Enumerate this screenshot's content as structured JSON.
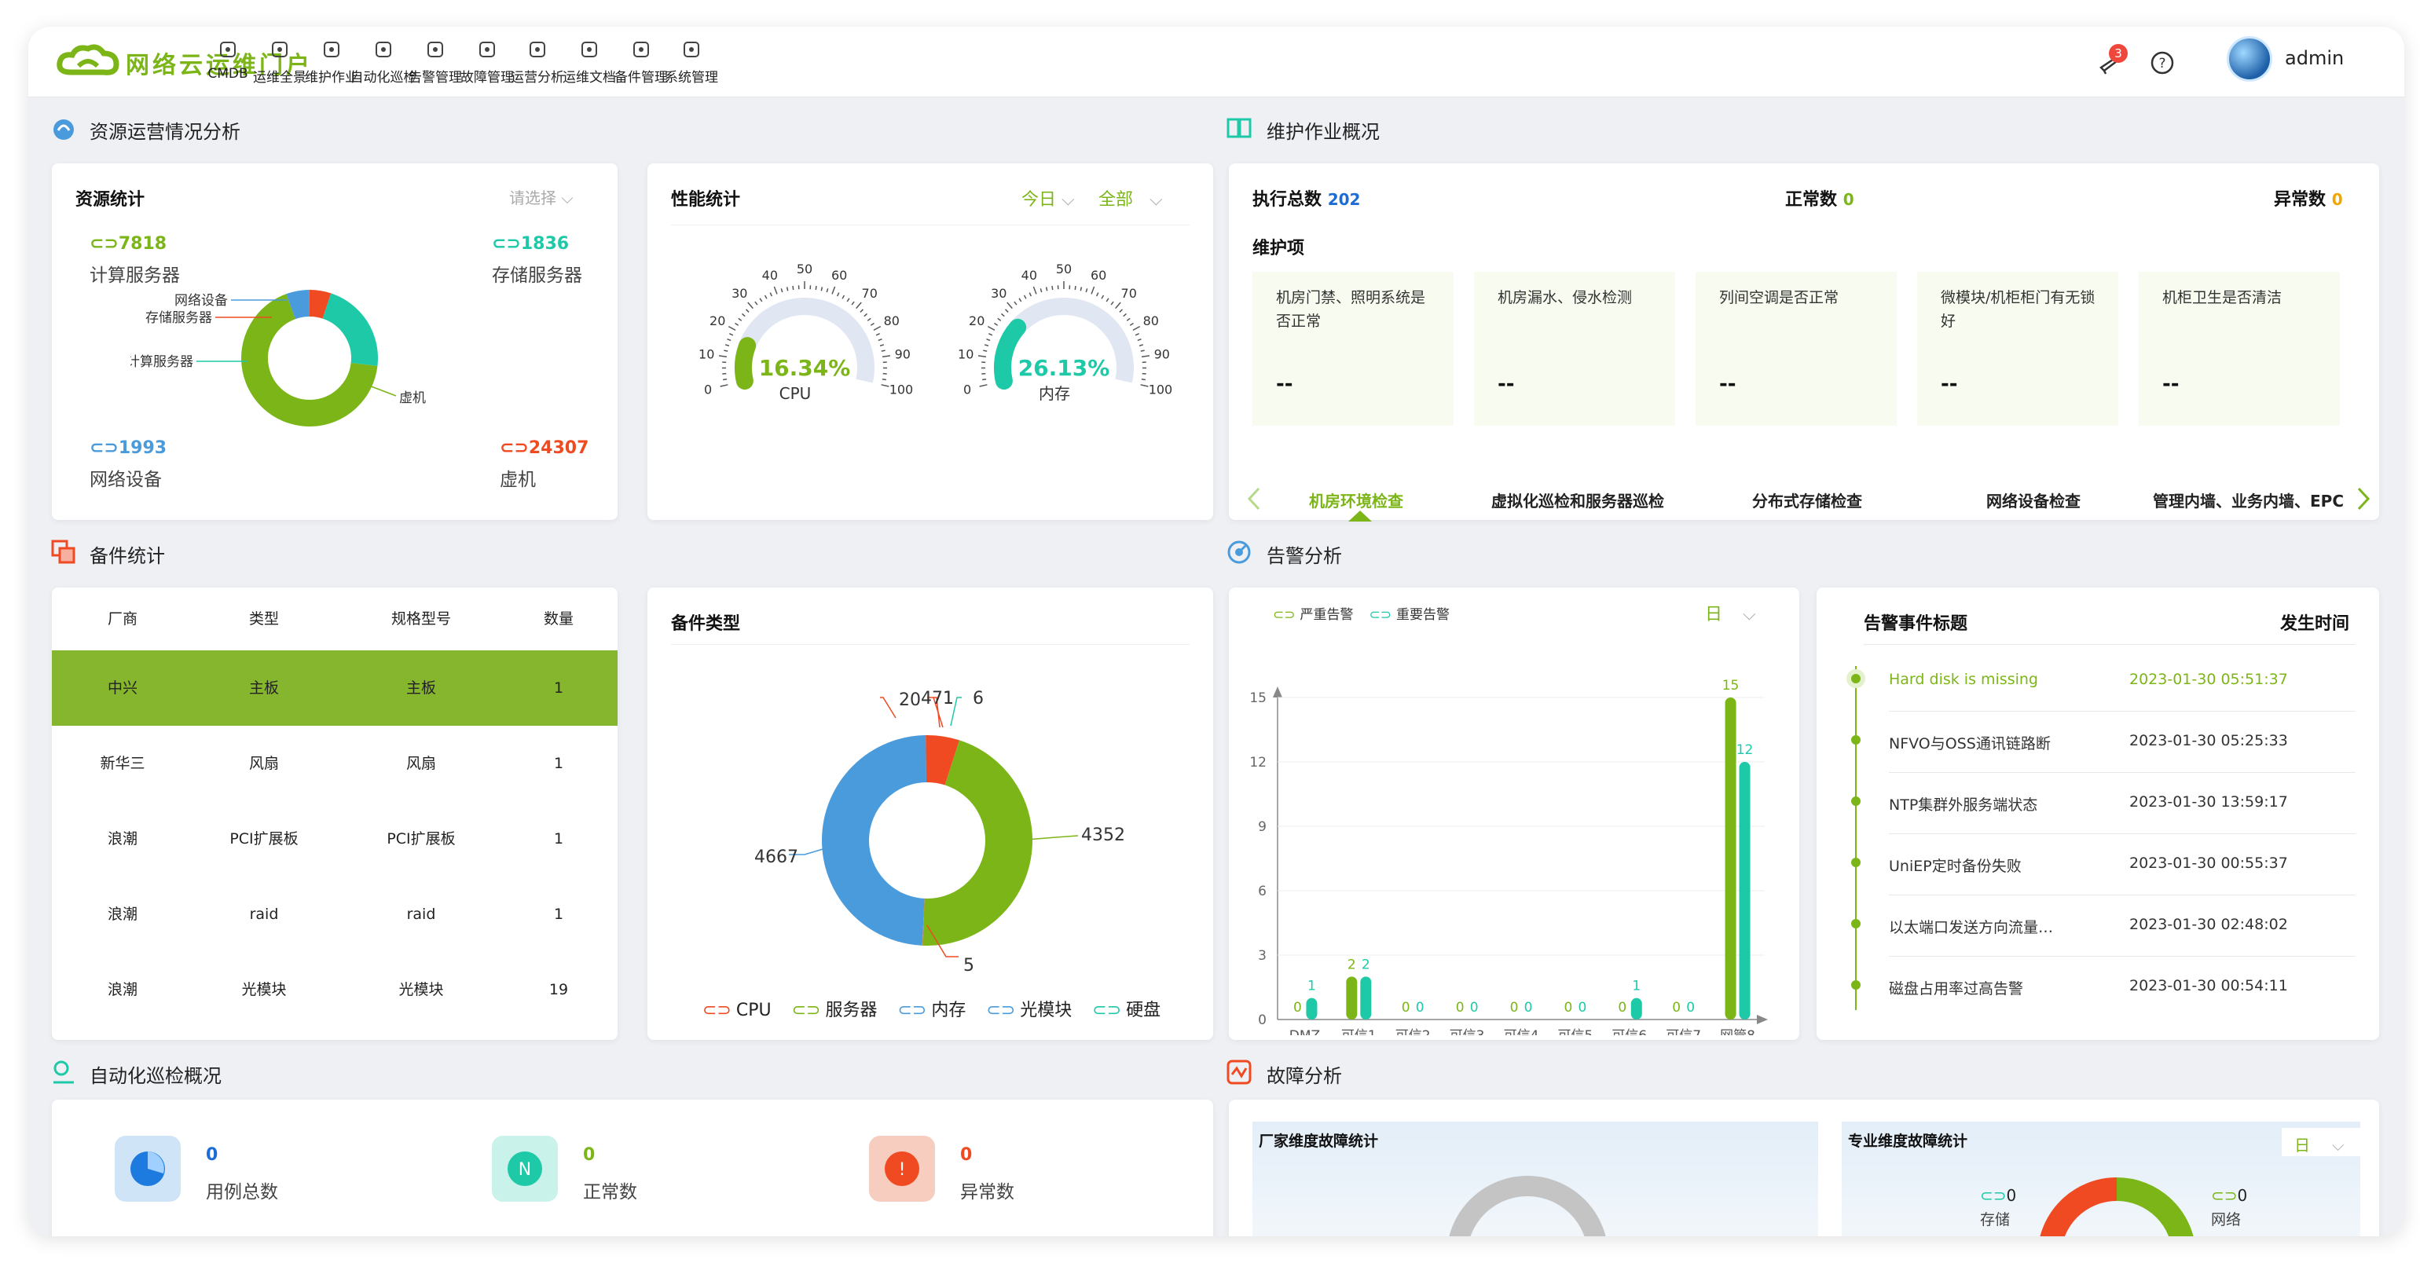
{
  "app": {
    "name": "网络云运维门户",
    "user": "admin",
    "notification_count": "3"
  },
  "nav": [
    {
      "label": "CMDB",
      "icon": "cube-icon"
    },
    {
      "label": "运维全景",
      "icon": "compass-icon"
    },
    {
      "label": "维护作业",
      "icon": "book-icon"
    },
    {
      "label": "自动化巡检",
      "icon": "location-icon"
    },
    {
      "label": "告警管理",
      "icon": "alarm-icon"
    },
    {
      "label": "故障管理",
      "icon": "warning-icon"
    },
    {
      "label": "运营分析",
      "icon": "chart-icon"
    },
    {
      "label": "运维文档",
      "icon": "document-icon"
    },
    {
      "label": "备件管理",
      "icon": "parts-icon"
    },
    {
      "label": "系统管理",
      "icon": "user-icon"
    }
  ],
  "sections": {
    "resource": "资源运营情况分析",
    "maintenance": "维护作业概况",
    "spare": "备件统计",
    "alarm": "告警分析",
    "inspection": "自动化巡检概况",
    "fault": "故障分析"
  },
  "resource_stats": {
    "title": "资源统计",
    "select_placeholder": "请选择",
    "items": [
      {
        "value": "7818",
        "label": "计算服务器"
      },
      {
        "value": "1836",
        "label": "存储服务器"
      },
      {
        "value": "1993",
        "label": "网络设备"
      },
      {
        "value": "24307",
        "label": "虚机"
      }
    ],
    "donut_labels": [
      "网络设备",
      "存储服务器",
      "计算服务器",
      "虚机"
    ],
    "colors": [
      "#7cb518",
      "#1ec9a8",
      "#f04a23",
      "#4a9bdc"
    ]
  },
  "performance": {
    "title": "性能统计",
    "period": "今日",
    "scope": "全部",
    "gauges": [
      {
        "value": "16.34%",
        "label": "CPU",
        "fraction": 0.1634,
        "color": "#7cb518"
      },
      {
        "value": "26.13%",
        "label": "内存",
        "fraction": 0.2613,
        "color": "#1ec9a8"
      }
    ],
    "ticks": [
      "0",
      "10",
      "20",
      "30",
      "40",
      "50",
      "60",
      "70",
      "80",
      "90",
      "100"
    ]
  },
  "maintenance": {
    "total_label": "执行总数",
    "total_value": "202",
    "normal_label": "正常数",
    "normal_value": "0",
    "abnormal_label": "异常数",
    "abnormal_value": "0",
    "items_title": "维护项",
    "cards": [
      {
        "title": "机房门禁、照明系统是否正常",
        "value": "--"
      },
      {
        "title": "机房漏水、侵水检测",
        "value": "--"
      },
      {
        "title": "列间空调是否正常",
        "value": "--"
      },
      {
        "title": "微模块/机柜柜门有无锁好",
        "value": "--"
      },
      {
        "title": "机柜卫生是否清洁",
        "value": "--"
      }
    ],
    "tabs": [
      "机房环境检查",
      "虚拟化巡检和服务器巡检",
      "分布式存储检查",
      "网络设备检查",
      "管理内墙、业务内墙、EPC"
    ]
  },
  "spare_table": {
    "headers": [
      "厂商",
      "类型",
      "规格型号",
      "数量"
    ],
    "rows": [
      [
        "中兴",
        "主板",
        "主板",
        "1"
      ],
      [
        "新华三",
        "风扇",
        "风扇",
        "1"
      ],
      [
        "浪潮",
        "PCI扩展板",
        "PCI扩展板",
        "1"
      ],
      [
        "浪潮",
        "raid",
        "raid",
        "1"
      ],
      [
        "浪潮",
        "光模块",
        "光模块",
        "19"
      ]
    ]
  },
  "spare_types": {
    "title": "备件类型",
    "legend": [
      "CPU",
      "服务器",
      "内存",
      "光模块",
      "硬盘"
    ],
    "colors": [
      "#f04a23",
      "#7cb518",
      "#4a9bdc",
      "#4a9bdc",
      "#1ec9a8"
    ],
    "chart_data": {
      "type": "pie",
      "categories": [
        "CPU",
        "服务器",
        "内存",
        "光模块",
        "硬盘"
      ],
      "values": [
        471,
        4352,
        5,
        4667,
        20
      ],
      "extra_labels": [
        "1",
        "6"
      ]
    }
  },
  "alarm_chart": {
    "legend": [
      "严重告警",
      "重要告警"
    ],
    "period": "日",
    "chart_data": {
      "type": "bar",
      "categories": [
        "DMZ",
        "可信1",
        "可信2",
        "可信3",
        "可信4",
        "可信5",
        "可信6",
        "可信7",
        "网管8"
      ],
      "series": [
        {
          "name": "严重告警",
          "values": [
            0,
            2,
            0,
            0,
            0,
            0,
            0,
            0,
            15
          ]
        },
        {
          "name": "重要告警",
          "values": [
            1,
            2,
            0,
            0,
            0,
            0,
            1,
            0,
            12
          ]
        }
      ],
      "ylim": [
        0,
        15
      ],
      "yticks": [
        "0",
        "3",
        "6",
        "9",
        "12",
        "15"
      ]
    },
    "colors": [
      "#7cb518",
      "#1ec9a8"
    ]
  },
  "alarm_events": {
    "title_header": "告警事件标题",
    "time_header": "发生时间",
    "rows": [
      {
        "title": "Hard disk is missing",
        "time": "2023-01-30 05:51:37"
      },
      {
        "title": "NFVO与OSS通讯链路断",
        "time": "2023-01-30 05:25:33"
      },
      {
        "title": "NTP集群外服务端状态",
        "time": "2023-01-30 13:59:17"
      },
      {
        "title": "UniEP定时备份失败",
        "time": "2023-01-30 00:55:37"
      },
      {
        "title": "以太端口发送方向流量…",
        "time": "2023-01-30 02:48:02"
      },
      {
        "title": "磁盘占用率过高告警",
        "time": "2023-01-30 00:54:11"
      }
    ]
  },
  "inspection": {
    "items": [
      {
        "value": "0",
        "label": "用例总数",
        "color": "#4a9bdc"
      },
      {
        "value": "0",
        "label": "正常数",
        "color": "#1ec9a8"
      },
      {
        "value": "0",
        "label": "异常数",
        "color": "#f04a23"
      }
    ]
  },
  "fault": {
    "vendor_title": "厂家维度故障统计",
    "major_title": "专业维度故障统计",
    "period": "日",
    "legend": [
      {
        "value": "0",
        "label": "存储"
      },
      {
        "value": "0",
        "label": "网络"
      }
    ]
  }
}
